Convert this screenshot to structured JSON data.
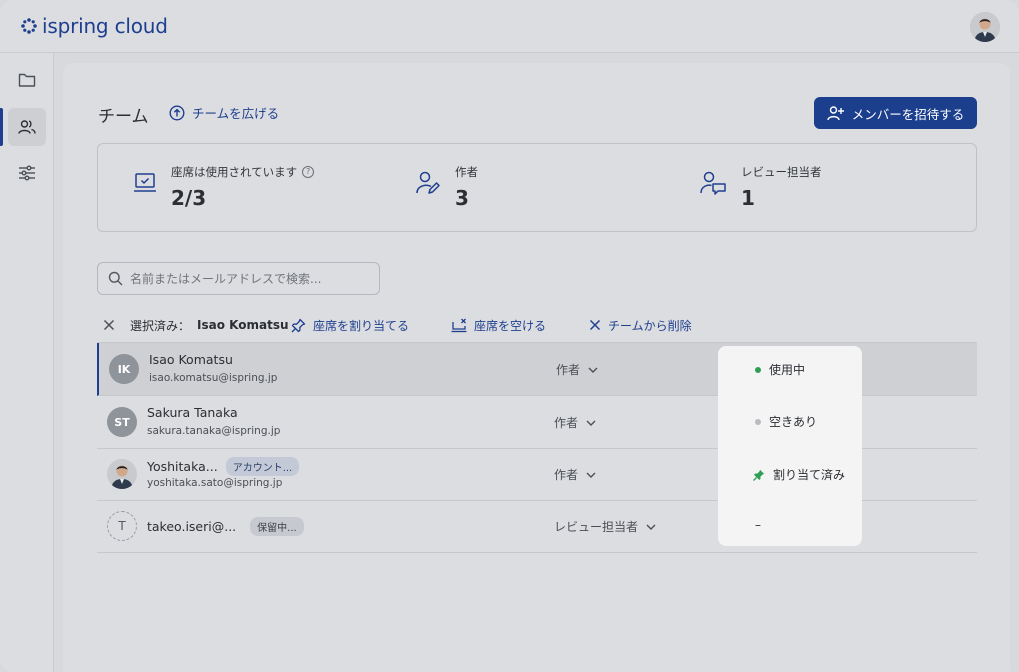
{
  "app": {
    "logo_text": "ispring cloud",
    "brand_color": "#1e3f8f"
  },
  "sidebar": {
    "items": [
      {
        "name": "folder-icon",
        "active": false
      },
      {
        "name": "users-icon",
        "active": true
      },
      {
        "name": "sliders-icon",
        "active": false
      }
    ]
  },
  "header": {
    "title": "チーム",
    "expand_label": "チームを広げる",
    "invite_label": "メンバーを招待する"
  },
  "stats": {
    "seats": {
      "label": "座席は使用されています",
      "value": "2/3",
      "icon": "laptop-check-icon"
    },
    "authors": {
      "label": "作者",
      "value": "3",
      "icon": "user-pen-icon"
    },
    "reviewers": {
      "label": "レビュー担当者",
      "value": "1",
      "icon": "user-comment-icon"
    }
  },
  "search": {
    "placeholder": "名前またはメールアドレスで検索..."
  },
  "actionbar": {
    "selected_prefix": "選択済み：",
    "selected_name": "Isao Komatsu",
    "assign_label": "座席を割り当てる",
    "free_label": "座席を空ける",
    "remove_label": "チームから削除"
  },
  "members": [
    {
      "initials": "IK",
      "name": "Isao Komatsu",
      "email": "isao.komatsu@ispring.jp",
      "role": "作者",
      "status": "使用中",
      "status_color": "#2e9e55",
      "selected": true
    },
    {
      "initials": "ST",
      "name": "Sakura Tanaka",
      "email": "sakura.tanaka@ispring.jp",
      "role": "作者",
      "status": "空きあり",
      "status_color": "#b8bbbf",
      "selected": false
    },
    {
      "initials": "",
      "name": "Yoshitaka...",
      "badge": "アカウント...",
      "email": "yoshitaka.sato@ispring.jp",
      "role": "作者",
      "status": "割り当て済み",
      "status_color": "#2e9e55",
      "selected": false
    },
    {
      "initials": "T",
      "name": "takeo.iseri@...",
      "badge": "保留中...",
      "email": "",
      "role": "レビュー担当者",
      "status": "–",
      "status_color": "",
      "selected": false
    }
  ]
}
